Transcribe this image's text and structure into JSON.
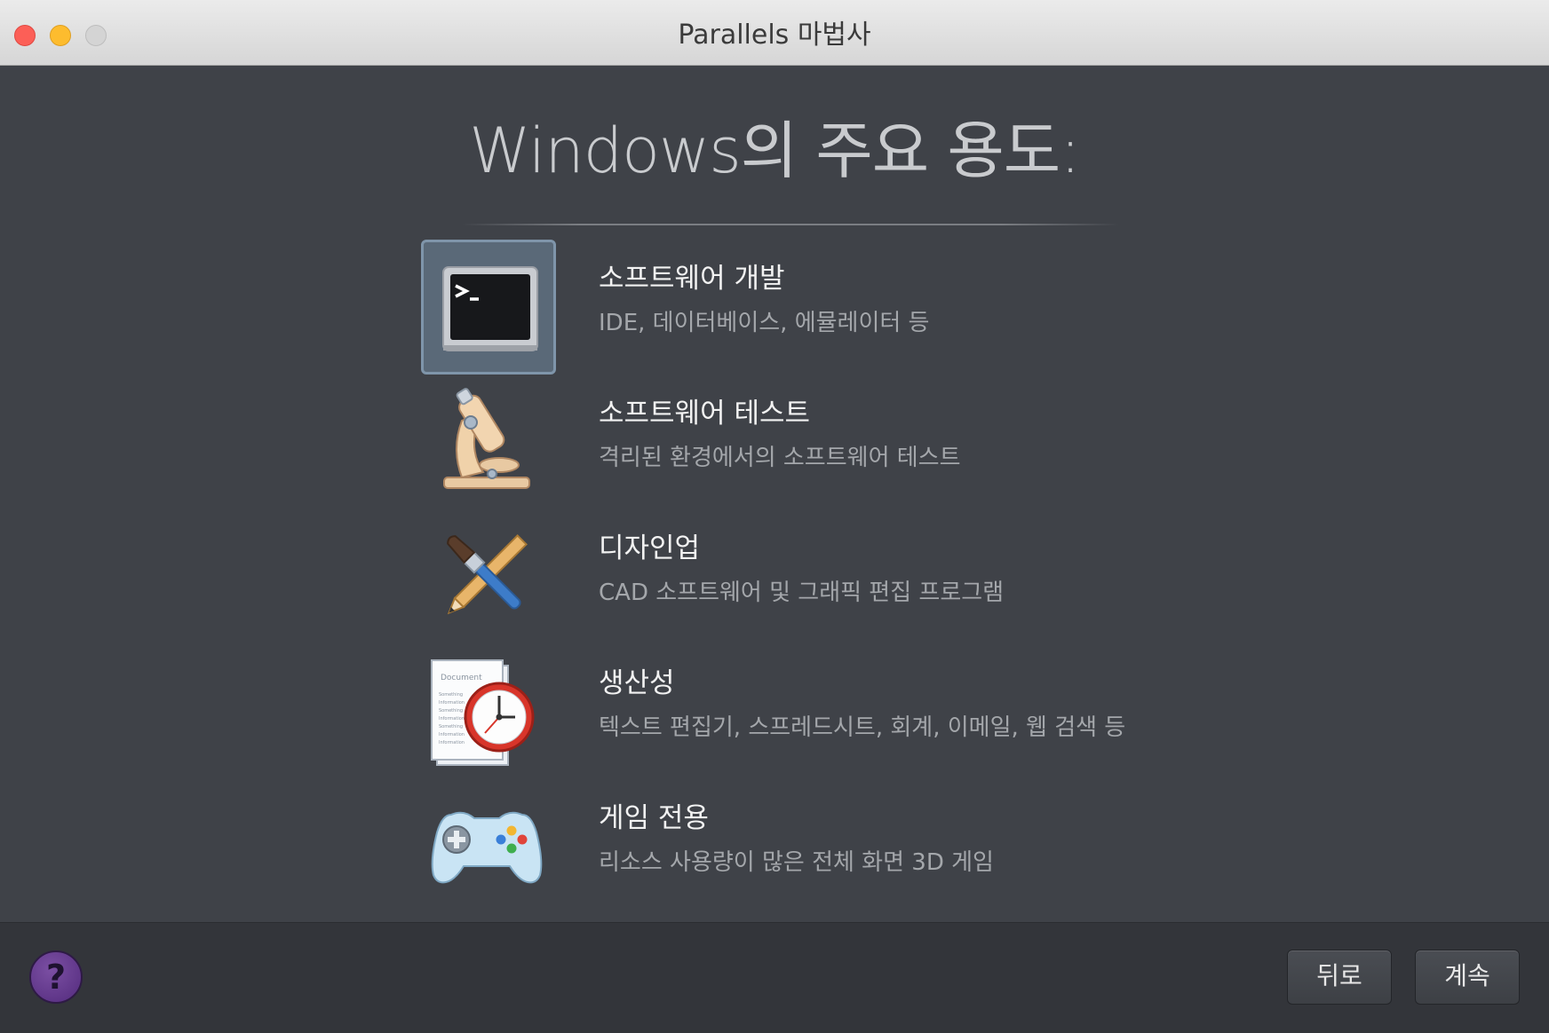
{
  "window": {
    "title": "Parallels 마법사"
  },
  "heading": "Windows의 주요 용도:",
  "options": [
    {
      "title": "소프트웨어 개발",
      "desc": "IDE, 데이터베이스, 에뮬레이터 등",
      "icon": "terminal-icon",
      "selected": true
    },
    {
      "title": "소프트웨어 테스트",
      "desc": "격리된 환경에서의 소프트웨어 테스트",
      "icon": "microscope-icon",
      "selected": false
    },
    {
      "title": "디자인업",
      "desc": "CAD 소프트웨어 및 그래픽 편집 프로그램",
      "icon": "design-tools-icon",
      "selected": false
    },
    {
      "title": "생산성",
      "desc": "텍스트 편집기, 스프레드시트, 회계, 이메일, 웹 검색 등",
      "icon": "document-clock-icon",
      "selected": false
    },
    {
      "title": "게임 전용",
      "desc": "리소스 사용량이 많은 전체 화면 3D 게임",
      "icon": "gamepad-icon",
      "selected": false
    }
  ],
  "icon_text": {
    "document_label": "Document",
    "document_lines": [
      "Something",
      "Information",
      "Something",
      "Information",
      "Something",
      "Information",
      "Information"
    ]
  },
  "footer": {
    "help_label": "?",
    "back_label": "뒤로",
    "continue_label": "계속"
  },
  "colors": {
    "selected_bg": "#5a6978",
    "selected_border": "#7f95aa",
    "window_bg": "#3f4248",
    "footer_bg": "#33353a"
  }
}
